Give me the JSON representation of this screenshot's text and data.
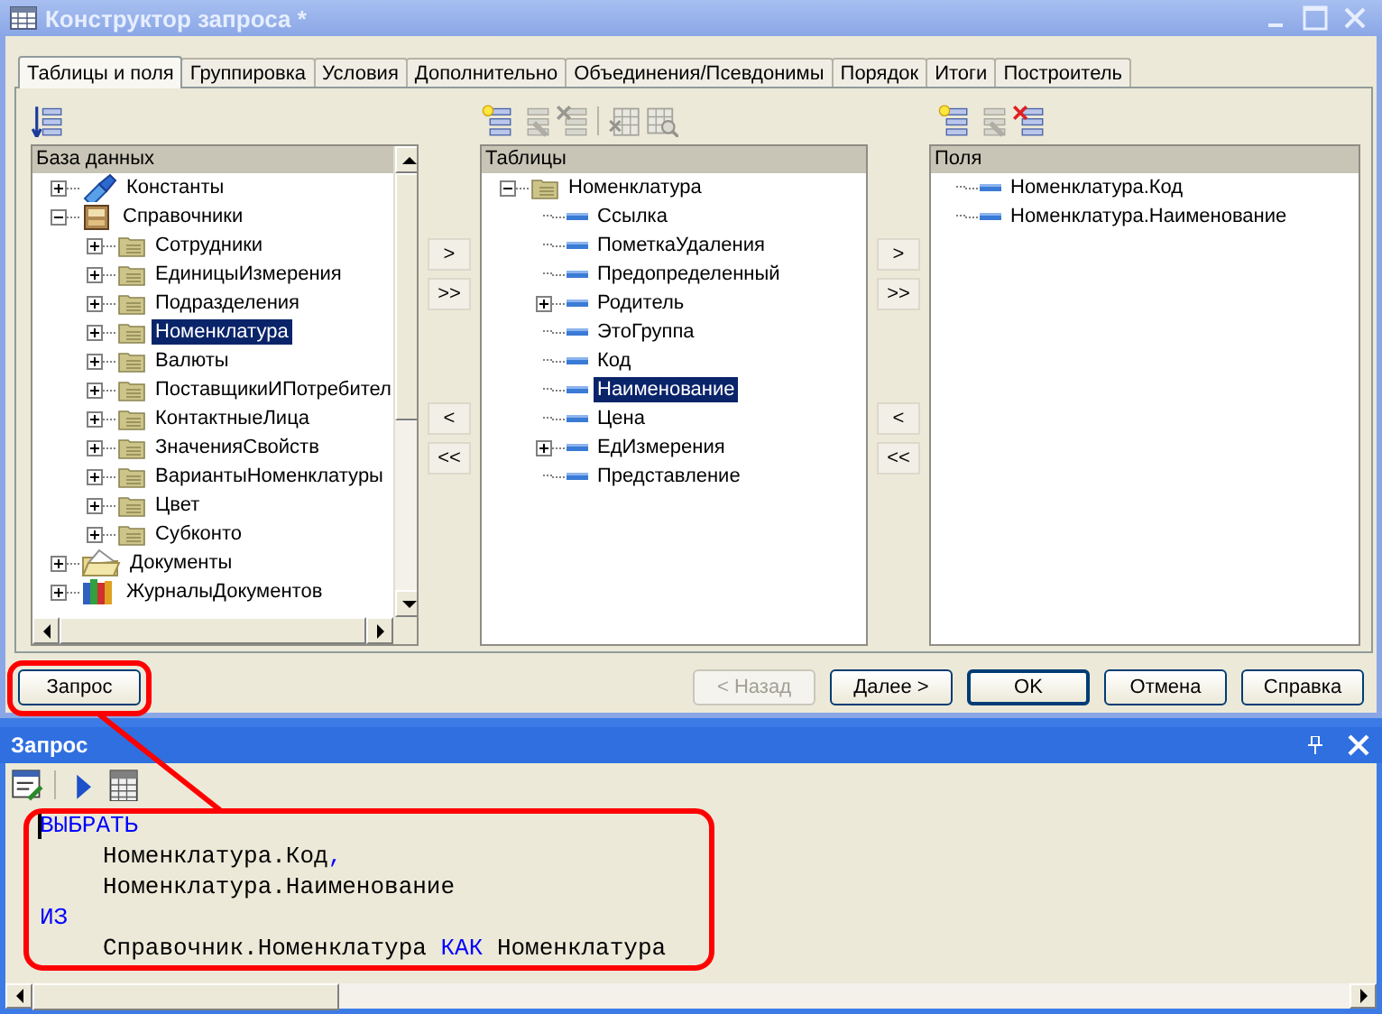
{
  "window": {
    "title": "Конструктор запроса *"
  },
  "tabs": [
    {
      "label": "Таблицы и поля",
      "selected": true
    },
    {
      "label": "Группировка",
      "selected": false
    },
    {
      "label": "Условия",
      "selected": false
    },
    {
      "label": "Дополнительно",
      "selected": false
    },
    {
      "label": "Объединения/Псевдонимы",
      "selected": false
    },
    {
      "label": "Порядок",
      "selected": false
    },
    {
      "label": "Итоги",
      "selected": false
    },
    {
      "label": "Построитель",
      "selected": false
    }
  ],
  "database_toolbar": [
    {
      "kind": "sort",
      "disabled": false
    }
  ],
  "tables_toolbar": [
    {
      "kind": "add",
      "disabled": false
    },
    {
      "kind": "edit",
      "disabled": true
    },
    {
      "kind": "delete",
      "disabled": true
    },
    {
      "kind": "table-check",
      "disabled": true
    },
    {
      "kind": "table-search",
      "disabled": true
    }
  ],
  "fields_toolbar": [
    {
      "kind": "add",
      "disabled": false
    },
    {
      "kind": "edit",
      "disabled": true
    },
    {
      "kind": "delete",
      "disabled": false
    }
  ],
  "database_tree": {
    "header": "База данных",
    "items": [
      {
        "label": "Константы",
        "kind": "constants",
        "expanded": false,
        "selected": false
      },
      {
        "label": "Справочники",
        "kind": "catalogs",
        "expanded": true,
        "selected": false,
        "children": [
          {
            "label": "Сотрудники",
            "kind": "table",
            "expanded": false,
            "selected": false
          },
          {
            "label": "ЕдиницыИзмерения",
            "kind": "table",
            "expanded": false,
            "selected": false
          },
          {
            "label": "Подразделения",
            "kind": "table",
            "expanded": false,
            "selected": false
          },
          {
            "label": "Номенклатура",
            "kind": "table",
            "expanded": false,
            "selected": true
          },
          {
            "label": "Валюты",
            "kind": "table",
            "expanded": false,
            "selected": false
          },
          {
            "label": "ПоставщикиИПотребител",
            "kind": "table",
            "expanded": false,
            "selected": false
          },
          {
            "label": "КонтактныеЛица",
            "kind": "table",
            "expanded": false,
            "selected": false
          },
          {
            "label": "ЗначенияСвойств",
            "kind": "table",
            "expanded": false,
            "selected": false
          },
          {
            "label": "ВариантыНоменклатуры",
            "kind": "table",
            "expanded": false,
            "selected": false
          },
          {
            "label": "Цвет",
            "kind": "table",
            "expanded": false,
            "selected": false
          },
          {
            "label": "Субконто",
            "kind": "table",
            "expanded": false,
            "selected": false
          }
        ]
      },
      {
        "label": "Документы",
        "kind": "documents",
        "expanded": false,
        "selected": false
      },
      {
        "label": "ЖурналыДокументов",
        "kind": "journals",
        "expanded": false,
        "selected": false
      }
    ]
  },
  "left_arrow_buttons": [
    {
      "label": ">"
    },
    {
      "label": ">>"
    },
    {
      "label": "<"
    },
    {
      "label": "<<"
    }
  ],
  "tables_tree": {
    "header": "Таблицы",
    "items": [
      {
        "label": "Номенклатура",
        "kind": "table",
        "expanded": true,
        "selected": false,
        "children": [
          {
            "label": "Ссылка",
            "kind": "field",
            "selected": false
          },
          {
            "label": "ПометкаУдаления",
            "kind": "field",
            "selected": false
          },
          {
            "label": "Предопределенный",
            "kind": "field",
            "selected": false
          },
          {
            "label": "Родитель",
            "kind": "field",
            "expanded": false,
            "selected": false
          },
          {
            "label": "ЭтоГруппа",
            "kind": "field",
            "selected": false
          },
          {
            "label": "Код",
            "kind": "field",
            "selected": false
          },
          {
            "label": "Наименование",
            "kind": "field",
            "selected": true
          },
          {
            "label": "Цена",
            "kind": "field",
            "selected": false
          },
          {
            "label": "ЕдИзмерения",
            "kind": "field",
            "expanded": false,
            "selected": false
          },
          {
            "label": "Представление",
            "kind": "field",
            "selected": false
          }
        ]
      }
    ]
  },
  "right_arrow_buttons": [
    {
      "label": ">"
    },
    {
      "label": ">>"
    },
    {
      "label": "<"
    },
    {
      "label": "<<"
    }
  ],
  "fields_list": {
    "header": "Поля",
    "items": [
      {
        "label": "Номенклатура.Код",
        "kind": "field",
        "selected": false
      },
      {
        "label": "Номенклатура.Наименование",
        "kind": "field",
        "selected": false
      }
    ]
  },
  "buttons": [
    {
      "label": "Запрос",
      "disabled": false,
      "default": false
    },
    {
      "label": "< Назад",
      "disabled": true,
      "default": false
    },
    {
      "label": "Далее >",
      "disabled": false,
      "default": false
    },
    {
      "label": "OK",
      "disabled": false,
      "default": true
    },
    {
      "label": "Отмена",
      "disabled": false,
      "default": false
    },
    {
      "label": "Справка",
      "disabled": false,
      "default": false
    }
  ],
  "query_panel": {
    "title": "Запрос",
    "toolbar": [
      {
        "kind": "edit-query",
        "disabled": false
      },
      {
        "kind": "run",
        "disabled": false
      },
      {
        "kind": "calc",
        "disabled": false
      }
    ],
    "code": [
      {
        "indented": false,
        "tokens": [
          {
            "text": "ВЫБРАТЬ",
            "kind": "keyword"
          }
        ]
      },
      {
        "indented": true,
        "tokens": [
          {
            "text": "Номенклатура.Код",
            "kind": "plain"
          },
          {
            "text": ",",
            "kind": "keyword"
          }
        ]
      },
      {
        "indented": true,
        "tokens": [
          {
            "text": "Номенклатура.Наименование",
            "kind": "plain"
          }
        ]
      },
      {
        "indented": false,
        "tokens": [
          {
            "text": "ИЗ",
            "kind": "keyword"
          }
        ]
      },
      {
        "indented": true,
        "tokens": [
          {
            "text": "Справочник.Номенклатура ",
            "kind": "plain"
          },
          {
            "text": "КАК",
            "kind": "keyword"
          },
          {
            "text": " Номенклатура",
            "kind": "plain"
          }
        ]
      }
    ]
  }
}
